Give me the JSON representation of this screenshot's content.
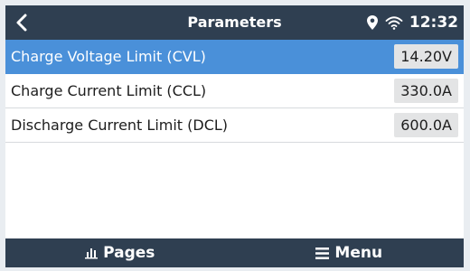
{
  "header": {
    "title": "Parameters",
    "time": "12:32",
    "back_icon": "chevron-left-icon",
    "location_icon": "location-pin-icon",
    "wifi_icon": "wifi-icon"
  },
  "parameters": [
    {
      "label": "Charge Voltage Limit (CVL)",
      "value": "14.20V",
      "selected": true
    },
    {
      "label": "Charge Current Limit (CCL)",
      "value": "330.0A",
      "selected": false
    },
    {
      "label": "Discharge Current Limit (DCL)",
      "value": "600.0A",
      "selected": false
    }
  ],
  "footer": {
    "pages_label": "Pages",
    "pages_icon": "bar-chart-icon",
    "menu_label": "Menu",
    "menu_icon": "hamburger-menu-icon"
  },
  "colors": {
    "header_bg": "#2f3f51",
    "selected_row_bg": "#4a90d9",
    "value_box_bg": "#e3e4e5"
  }
}
